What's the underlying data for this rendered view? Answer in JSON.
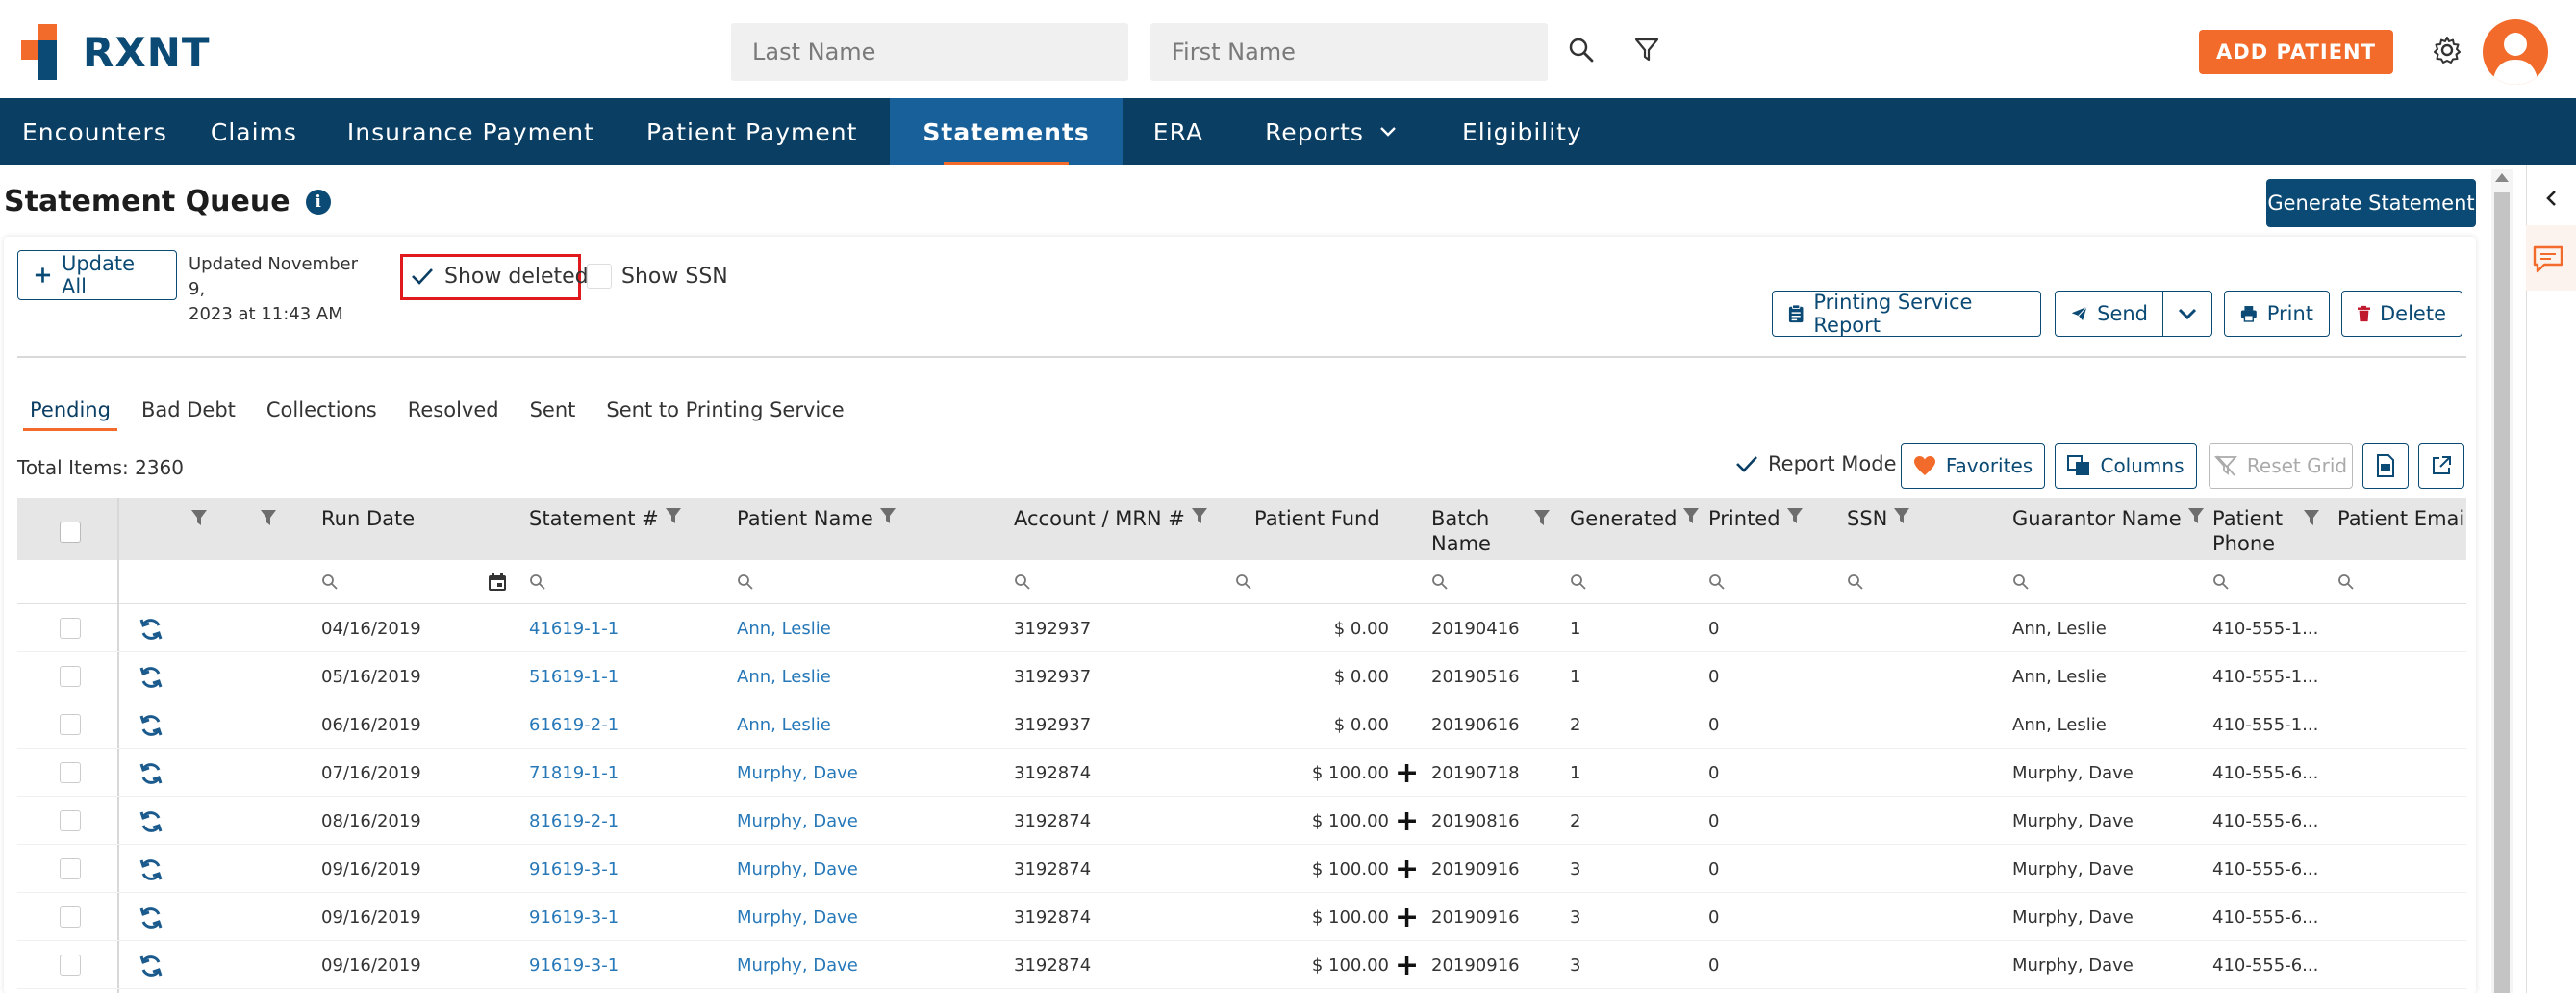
{
  "brand": {
    "name": "RXNT",
    "orange": "#f26b2a",
    "navy": "#0b3e63",
    "blue": "#0b4a74"
  },
  "header": {
    "lastname_placeholder": "Last Name",
    "firstname_placeholder": "First Name",
    "add_patient": "ADD PATIENT"
  },
  "nav": {
    "items": [
      "Encounters",
      "Claims",
      "Insurance Payment",
      "Patient Payment",
      "Statements",
      "ERA",
      "Reports",
      "Eligibility"
    ],
    "active": "Statements"
  },
  "page": {
    "title": "Statement Queue",
    "generate": "Generate Statement",
    "update_all": "Update All",
    "updated_line1": "Updated November 9,",
    "updated_line2": "2023 at 11:43 AM",
    "show_deleted": "Show deleted",
    "show_ssn": "Show SSN",
    "printing_service_report": "Printing Service Report",
    "send": "Send",
    "print": "Print",
    "delete": "Delete",
    "tabs": [
      "Pending",
      "Bad Debt",
      "Collections",
      "Resolved",
      "Sent",
      "Sent to Printing Service"
    ],
    "active_tab": "Pending",
    "total_items": "Total Items: 2360",
    "report_mode": "Report Mode",
    "favorites": "Favorites",
    "columns": "Columns",
    "reset_grid": "Reset Grid"
  },
  "grid": {
    "headers": {
      "run_date": "Run Date",
      "statement": "Statement #",
      "patient_name": "Patient Name",
      "account": "Account / MRN #",
      "patient_fund": "Patient Fund",
      "batch_name_1": "Batch",
      "batch_name_2": "Name",
      "generated": "Generated",
      "printed": "Printed",
      "ssn": "SSN",
      "guarantor": "Guarantor Name",
      "phone_1": "Patient",
      "phone_2": "Phone",
      "email": "Patient Email"
    },
    "rows": [
      {
        "run_date": "04/16/2019",
        "statement": "41619-1-1",
        "patient": "Ann, Leslie",
        "account": "3192937",
        "fund": "$ 0.00",
        "plus": "",
        "batch": "20190416",
        "generated": "1",
        "printed": "0",
        "guarantor": "Ann, Leslie",
        "phone": "410-555-1..."
      },
      {
        "run_date": "05/16/2019",
        "statement": "51619-1-1",
        "patient": "Ann, Leslie",
        "account": "3192937",
        "fund": "$ 0.00",
        "plus": "",
        "batch": "20190516",
        "generated": "1",
        "printed": "0",
        "guarantor": "Ann, Leslie",
        "phone": "410-555-1..."
      },
      {
        "run_date": "06/16/2019",
        "statement": "61619-2-1",
        "patient": "Ann, Leslie",
        "account": "3192937",
        "fund": "$ 0.00",
        "plus": "",
        "batch": "20190616",
        "generated": "2",
        "printed": "0",
        "guarantor": "Ann, Leslie",
        "phone": "410-555-1..."
      },
      {
        "run_date": "07/16/2019",
        "statement": "71819-1-1",
        "patient": "Murphy, Dave",
        "account": "3192874",
        "fund": "$ 100.00",
        "plus": "+",
        "batch": "20190718",
        "generated": "1",
        "printed": "0",
        "guarantor": "Murphy, Dave",
        "phone": "410-555-6..."
      },
      {
        "run_date": "08/16/2019",
        "statement": "81619-2-1",
        "patient": "Murphy, Dave",
        "account": "3192874",
        "fund": "$ 100.00",
        "plus": "+",
        "batch": "20190816",
        "generated": "2",
        "printed": "0",
        "guarantor": "Murphy, Dave",
        "phone": "410-555-6..."
      },
      {
        "run_date": "09/16/2019",
        "statement": "91619-3-1",
        "patient": "Murphy, Dave",
        "account": "3192874",
        "fund": "$ 100.00",
        "plus": "+",
        "batch": "20190916",
        "generated": "3",
        "printed": "0",
        "guarantor": "Murphy, Dave",
        "phone": "410-555-6..."
      },
      {
        "run_date": "09/16/2019",
        "statement": "91619-3-1",
        "patient": "Murphy, Dave",
        "account": "3192874",
        "fund": "$ 100.00",
        "plus": "+",
        "batch": "20190916",
        "generated": "3",
        "printed": "0",
        "guarantor": "Murphy, Dave",
        "phone": "410-555-6..."
      },
      {
        "run_date": "09/16/2019",
        "statement": "91619-3-1",
        "patient": "Murphy, Dave",
        "account": "3192874",
        "fund": "$ 100.00",
        "plus": "+",
        "batch": "20190916",
        "generated": "3",
        "printed": "0",
        "guarantor": "Murphy, Dave",
        "phone": "410-555-6..."
      }
    ]
  }
}
